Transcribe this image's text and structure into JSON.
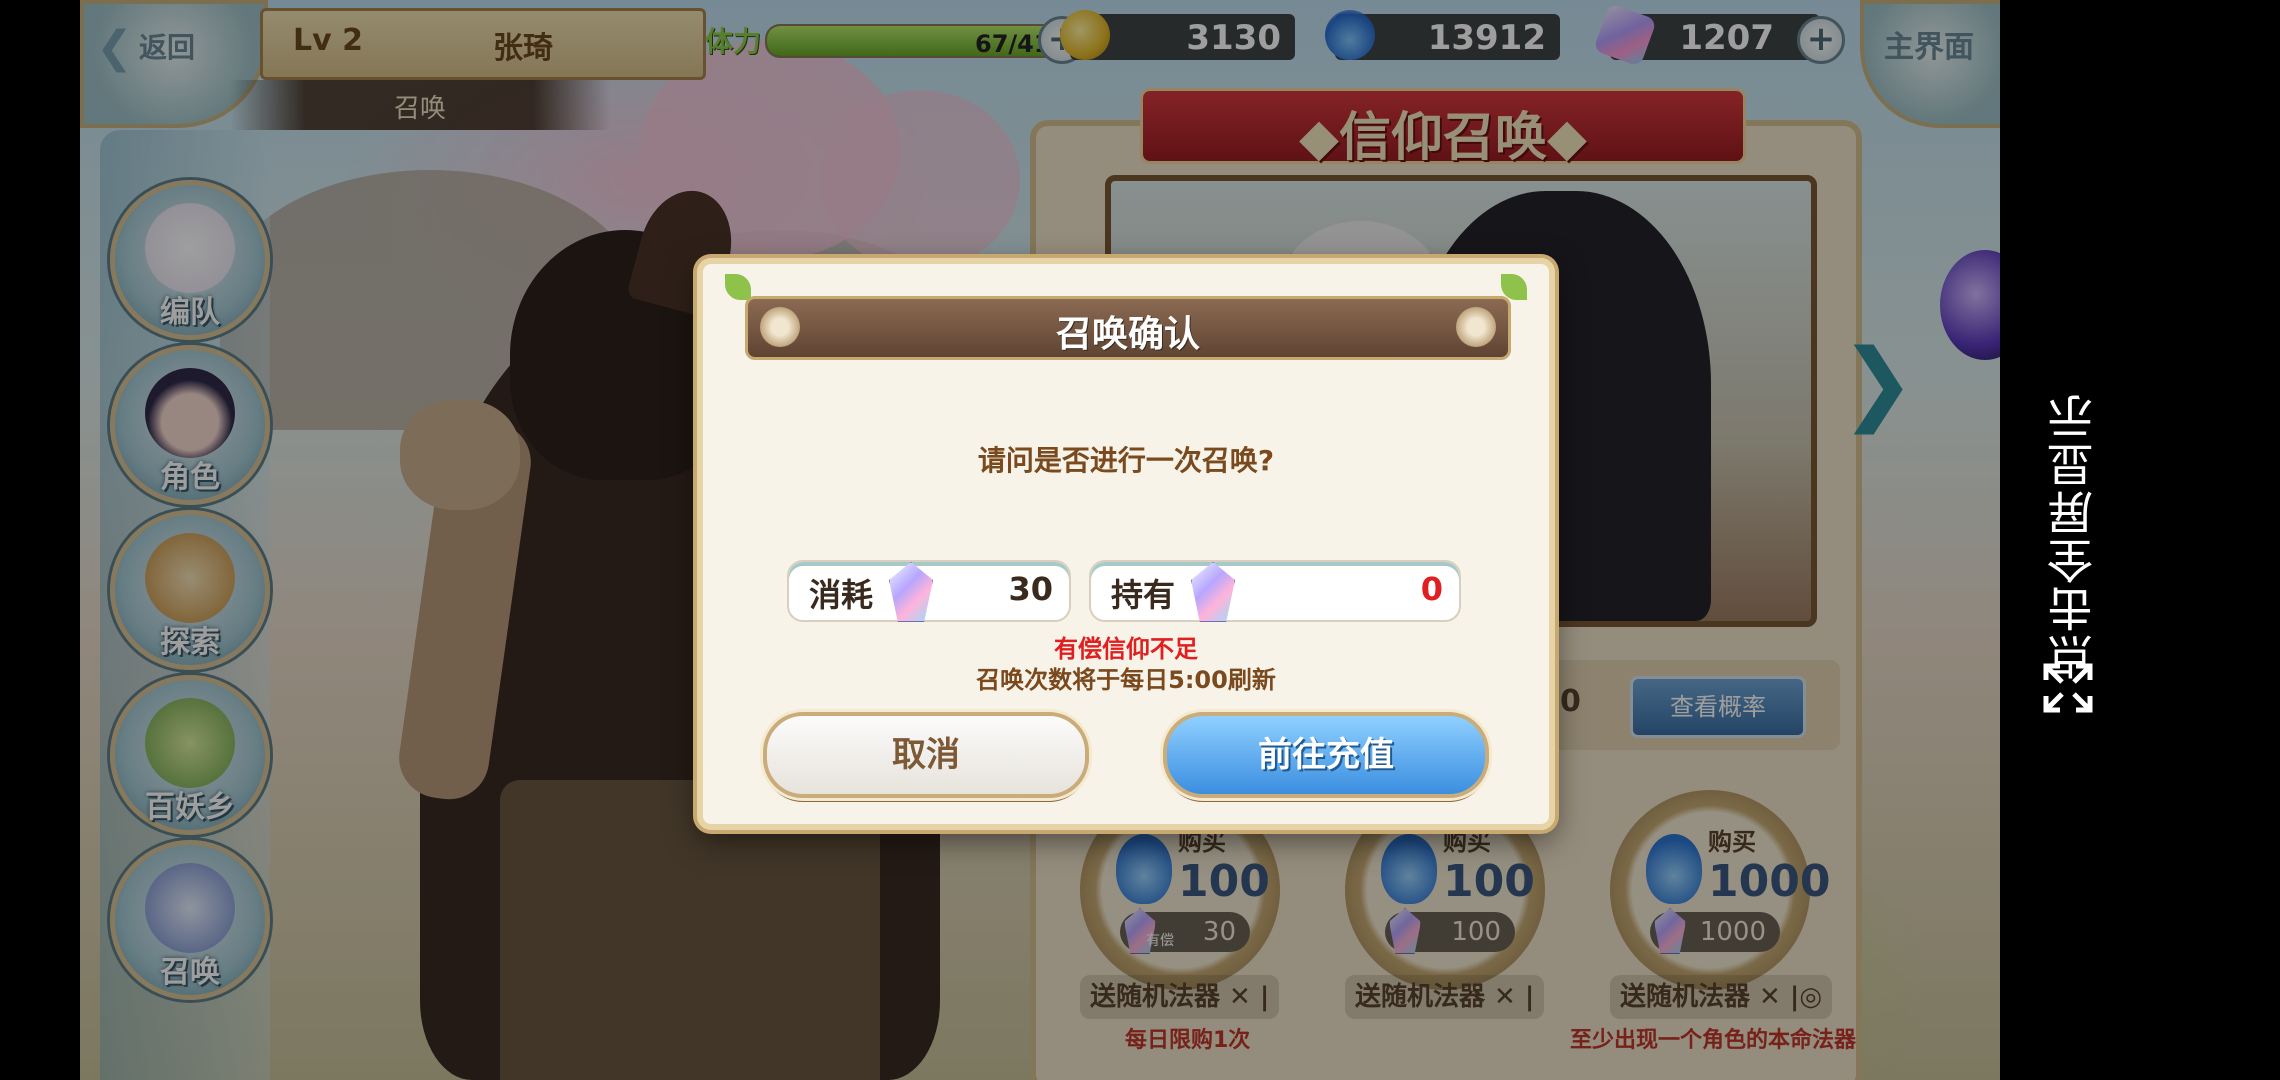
{
  "topbar": {
    "back_label": "返回",
    "level": "Lv 2",
    "player_name": "张琦",
    "section_tab": "召唤",
    "stamina_label": "体力",
    "stamina_value": "67/41",
    "stamina_fill_fraction": 1.0,
    "coins": "3130",
    "flames": "13912",
    "gems": "1207",
    "home_label": "主界面"
  },
  "sidebar": {
    "items": [
      {
        "label": "编队",
        "icon": "party-icon"
      },
      {
        "label": "角色",
        "icon": "character-icon"
      },
      {
        "label": "探索",
        "icon": "explore-icon"
      },
      {
        "label": "百妖乡",
        "icon": "village-icon"
      },
      {
        "label": "召唤",
        "icon": "summon-icon"
      }
    ]
  },
  "summon_panel": {
    "banner_title": "◆信仰召唤◆",
    "count_value": "0",
    "rate_button": "查看概率",
    "packs": [
      {
        "buy": "购买",
        "amount": "100",
        "cost": "30",
        "paid_tag": "有偿",
        "gift": "送随机法器 ✕ |",
        "note": "每日限购1次"
      },
      {
        "buy": "购买",
        "amount": "100",
        "cost": "100",
        "gift": "送随机法器 ✕ |"
      },
      {
        "buy": "购买",
        "amount": "1000",
        "cost": "1000",
        "gift": "送随机法器 ✕ |◎",
        "note": "至少出现一个角色的本命法器"
      }
    ]
  },
  "dialog": {
    "title": "召唤确认",
    "question": "请问是否进行一次召唤?",
    "cost_label": "消耗",
    "cost_value": "30",
    "own_label": "持有",
    "own_value": "0",
    "warning": "有偿信仰不足",
    "refresh_note": "召唤次数将于每日5:00刷新",
    "cancel_button": "取消",
    "topup_button": "前往充值"
  },
  "fullscreen_hint": "点击全屏显示",
  "colors": {
    "warning_red": "#e02020",
    "dialog_text_brown": "#7a4a1e",
    "topup_blue": "#3b8ee0"
  }
}
